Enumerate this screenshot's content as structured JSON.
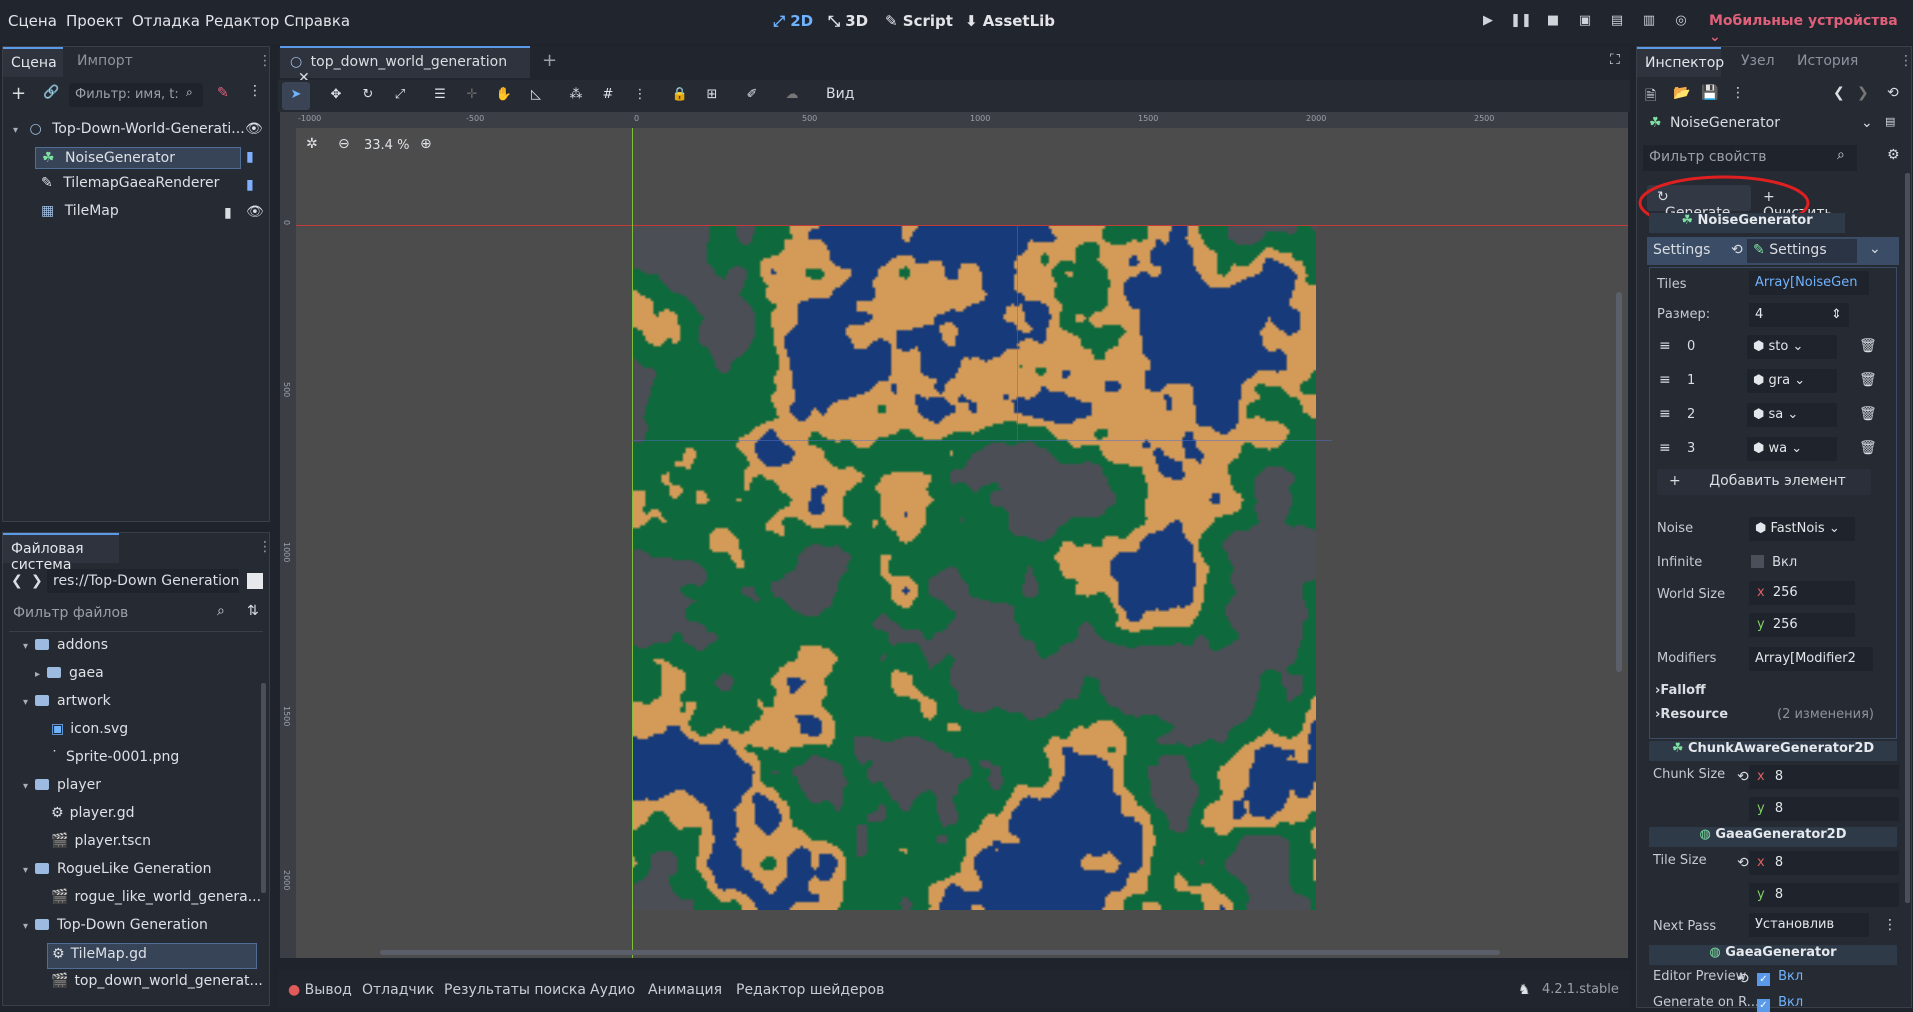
{
  "menu": [
    "Сцена",
    "Проект",
    "Отладка",
    "Редактор",
    "Справка"
  ],
  "modes": {
    "d2": "2D",
    "d3": "3D",
    "script": "Script",
    "assetlib": "AssetLib"
  },
  "renderer": "Мобильные устройства",
  "scene_panel": {
    "tab_scene": "Сцена",
    "tab_import": "Импорт",
    "filter_placeholder": "Фильтр: имя, t:",
    "nodes": [
      "Top-Down-World-Generati...",
      "NoiseGenerator",
      "TilemapGaeaRenderer",
      "TileMap"
    ]
  },
  "fs_panel": {
    "title": "Файловая система",
    "path": "res://Top-Down Generation",
    "filter_placeholder": "Фильтр файлов",
    "items": [
      "addons",
      "gaea",
      "artwork",
      "icon.svg",
      "Sprite-0001.png",
      "player",
      "player.gd",
      "player.tscn",
      "RogueLike Generation",
      "rogue_like_world_genera...",
      "Top-Down Generation",
      "TileMap.gd",
      "top_down_world_generat..."
    ]
  },
  "editor": {
    "tab": "top_down_world_generation",
    "view_menu": "Вид",
    "zoom": "33.4 %",
    "ruler_top": [
      "-1000",
      "-500",
      "0",
      "500",
      "1000",
      "1500",
      "2000",
      "2500"
    ],
    "ruler_left": [
      "0",
      "500",
      "1000",
      "1500",
      "2000"
    ]
  },
  "map": {
    "width": 256,
    "height": 256,
    "tiles": [
      "stone",
      "grass",
      "sand",
      "water"
    ],
    "colors": {
      "stone": "#4b4e55",
      "grass": "#0e6a3c",
      "sand": "#d49b58",
      "water": "#163a7a"
    }
  },
  "inspector": {
    "tabs": [
      "Инспектор",
      "Узел",
      "История"
    ],
    "node_name": "NoiseGenerator",
    "filter_placeholder": "Фильтр свойств",
    "generate": "Generate",
    "clear": "Очистить",
    "class_title": "NoiseGenerator",
    "settings_label": "Settings",
    "settings_value": "Settings",
    "tiles_label": "Tiles",
    "tiles_value": "Array[NoiseGen",
    "size_label": "Размер:",
    "size_value": "4",
    "tile_items": [
      {
        "idx": "0",
        "val": "sto"
      },
      {
        "idx": "1",
        "val": "gra"
      },
      {
        "idx": "2",
        "val": "sa"
      },
      {
        "idx": "3",
        "val": "wa"
      }
    ],
    "add_element": "Добавить элемент",
    "noise_label": "Noise",
    "noise_value": "FastNois",
    "infinite_label": "Infinite",
    "infinite_value": "Вкл",
    "world_size_label": "World Size",
    "world_x": "256",
    "world_y": "256",
    "modifiers_label": "Modifiers",
    "modifiers_value": "Array[Modifier2",
    "falloff": "Falloff",
    "resource": "Resource",
    "resource_changes": "(2 изменения)",
    "chunk_section": "ChunkAwareGenerator2D",
    "chunk_size_label": "Chunk Size",
    "chunk_x": "8",
    "chunk_y": "8",
    "gaea_section": "GaeaGenerator2D",
    "tile_size_label": "Tile Size",
    "tile_x": "8",
    "tile_y": "8",
    "next_pass_label": "Next Pass",
    "next_pass_value": "Установлив",
    "gaea2_section": "GaeaGenerator",
    "editor_preview_label": "Editor Preview",
    "editor_preview_value": "Вкл",
    "generate_on_label": "Generate on R...",
    "generate_on_value": "Вкл",
    "axis_x": "x",
    "axis_y": "y"
  },
  "bottom": {
    "output": "Вывод",
    "debugger": "Отладчик",
    "search": "Результаты поиска",
    "audio": "Аудио",
    "animation": "Анимация",
    "shader": "Редактор шейдеров",
    "version": "4.2.1.stable"
  }
}
